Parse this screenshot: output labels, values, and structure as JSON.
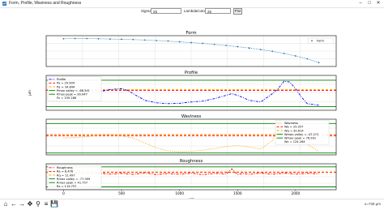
{
  "window": {
    "title": "Form, Profile, Waviness and Roughness",
    "minimize_icon": "minimize-icon",
    "maximize_icon": "maximize-icon",
    "close_icon": "close-icon"
  },
  "controls": {
    "sigma_label": "Sigma:",
    "sigma_value": "25",
    "lambda_label": "LambdaCutoff(mm):",
    "lambda_value": "25",
    "plot_button": "Plot"
  },
  "toolbar": {
    "icons": [
      "home-icon",
      "back-arrow-icon",
      "forward-arrow-icon",
      "pan-icon",
      "zoom-icon",
      "configure-icon",
      "save-icon"
    ],
    "coords": "x=730 μm"
  },
  "colors": {
    "form": "#1f77b4",
    "profile": "#0000ff",
    "waviness": "#ffa500",
    "roughness": "#ff0000",
    "mean_line": "#ff0000",
    "peak_line": "#ffa500",
    "valley_line": "#008000",
    "grid": "#d9d9d9"
  },
  "chart_data": [
    {
      "type": "scatter",
      "title": "Form",
      "xlabel": "",
      "ylabel": "",
      "xlim": [
        -150,
        2350
      ],
      "ylim": [
        -10,
        110
      ],
      "grid": true,
      "legend_position": "right",
      "series": [
        {
          "name": "Form",
          "style": "dots",
          "color": "#1f77b4",
          "x": [
            0,
            100,
            200,
            300,
            400,
            500,
            600,
            700,
            800,
            900,
            1000,
            1100,
            1200,
            1300,
            1400,
            1500,
            1600,
            1700,
            1800,
            1900,
            2000,
            2100,
            2200
          ],
          "y": [
            98,
            99,
            99,
            98,
            97,
            96,
            95,
            93,
            91,
            89,
            86,
            83,
            80,
            76,
            72,
            67,
            62,
            56,
            49,
            41,
            31,
            20,
            5
          ]
        }
      ]
    },
    {
      "type": "line",
      "title": "Profile",
      "xlabel": "",
      "ylabel": "μm",
      "xlim": [
        -150,
        2350
      ],
      "ylim": [
        -90,
        120
      ],
      "grid": true,
      "legend_position": "top-left",
      "series": [
        {
          "name": "Profile",
          "style": "dashdot",
          "color": "#0000ff",
          "x": [
            0,
            100,
            200,
            300,
            400,
            500,
            550,
            600,
            700,
            800,
            900,
            1000,
            1100,
            1200,
            1300,
            1400,
            1450,
            1500,
            1600,
            1700,
            1800,
            1850,
            1900,
            1950,
            2000,
            2050,
            2100,
            2200
          ],
          "y": [
            -10,
            0,
            10,
            20,
            35,
            40,
            30,
            10,
            -30,
            -45,
            -50,
            -48,
            -40,
            -35,
            -20,
            0,
            10,
            0,
            -30,
            -40,
            10,
            40,
            85,
            80,
            40,
            -10,
            -50,
            -60
          ]
        },
        {
          "name": "Pa = 29.904",
          "style": "dashed",
          "color": "#ff0000",
          "y_const": 29.904
        },
        {
          "name": "Pq = 34.844",
          "style": "dashed",
          "color": "#ffa500",
          "y_const": 34.844
        },
        {
          "name": "Pmax valley = -68.341",
          "style": "solid",
          "color": "#008000",
          "y_const": -68.341
        },
        {
          "name": "Pmax peak = 90.947",
          "style": "solid",
          "color": "#008000",
          "y_const": 90.947
        },
        {
          "name": "Pz = 159.288",
          "style": "none",
          "color": "#ffffff"
        }
      ]
    },
    {
      "type": "line",
      "title": "Waviness",
      "xlabel": "",
      "ylabel": "",
      "xlim": [
        -150,
        2350
      ],
      "ylim": [
        -55,
        95
      ],
      "grid": true,
      "legend_position": "top-right",
      "series": [
        {
          "name": "Waviness",
          "style": "dotted",
          "color": "#ffa500",
          "x": [
            0,
            100,
            200,
            300,
            400,
            500,
            600,
            700,
            800,
            900,
            1000,
            1100,
            1200,
            1300,
            1400,
            1500,
            1600,
            1700,
            1800,
            1850,
            1900,
            1950,
            2000,
            2100,
            2200
          ],
          "y": [
            15,
            18,
            22,
            28,
            30,
            26,
            15,
            -5,
            -25,
            -38,
            -42,
            -40,
            -35,
            -28,
            -20,
            -15,
            -22,
            -30,
            5,
            50,
            78,
            72,
            40,
            -10,
            -40
          ]
        },
        {
          "name": "Wa = 25.957",
          "style": "dashed",
          "color": "#ff0000",
          "y_const": 25.957
        },
        {
          "name": "Wq = 30.614",
          "style": "dashed",
          "color": "#ffa500",
          "y_const": 30.614
        },
        {
          "name": "Wmax valley = -47.272",
          "style": "solid",
          "color": "#008000",
          "y_const": -47.272
        },
        {
          "name": "Wmax peak = 76.991",
          "style": "solid",
          "color": "#008000",
          "y_const": 76.991
        },
        {
          "name": "Wz = 124.264",
          "style": "none",
          "color": "#ffffff"
        }
      ]
    },
    {
      "type": "line",
      "title": "Roughness",
      "xlabel": "μm",
      "ylabel": "",
      "xlim": [
        -150,
        2350
      ],
      "ylim": [
        -95,
        60
      ],
      "grid": true,
      "legend_position": "top-left",
      "xticks": [
        0,
        500,
        1000,
        1500,
        2000
      ],
      "series": [
        {
          "name": "Roughness",
          "style": "dashdot",
          "color": "#ff0000",
          "x": [
            0,
            100,
            200,
            300,
            400,
            500,
            600,
            700,
            800,
            900,
            1000,
            1100,
            1200,
            1300,
            1400,
            1450,
            1500,
            1550,
            1600,
            1700,
            1800,
            1900,
            2000,
            2100,
            2200
          ],
          "y": [
            0,
            5,
            -3,
            4,
            -2,
            3,
            -4,
            6,
            -5,
            2,
            -3,
            4,
            -6,
            3,
            -2,
            30,
            -5,
            3,
            -4,
            5,
            -3,
            4,
            -2,
            3,
            0
          ]
        },
        {
          "name": "Ra = 8.476",
          "style": "dashed",
          "color": "#ff0000",
          "y_const": 8.476
        },
        {
          "name": "Rq = 11.497",
          "style": "dashed",
          "color": "#ffa500",
          "y_const": 11.497
        },
        {
          "name": "Rmax valley = -77.999",
          "style": "solid",
          "color": "#008000",
          "y_const": -77.999
        },
        {
          "name": "Rmax peak = 41.757",
          "style": "solid",
          "color": "#008000",
          "y_const": 41.757
        },
        {
          "name": "Rz = 119.757",
          "style": "none",
          "color": "#ffffff"
        }
      ]
    }
  ]
}
